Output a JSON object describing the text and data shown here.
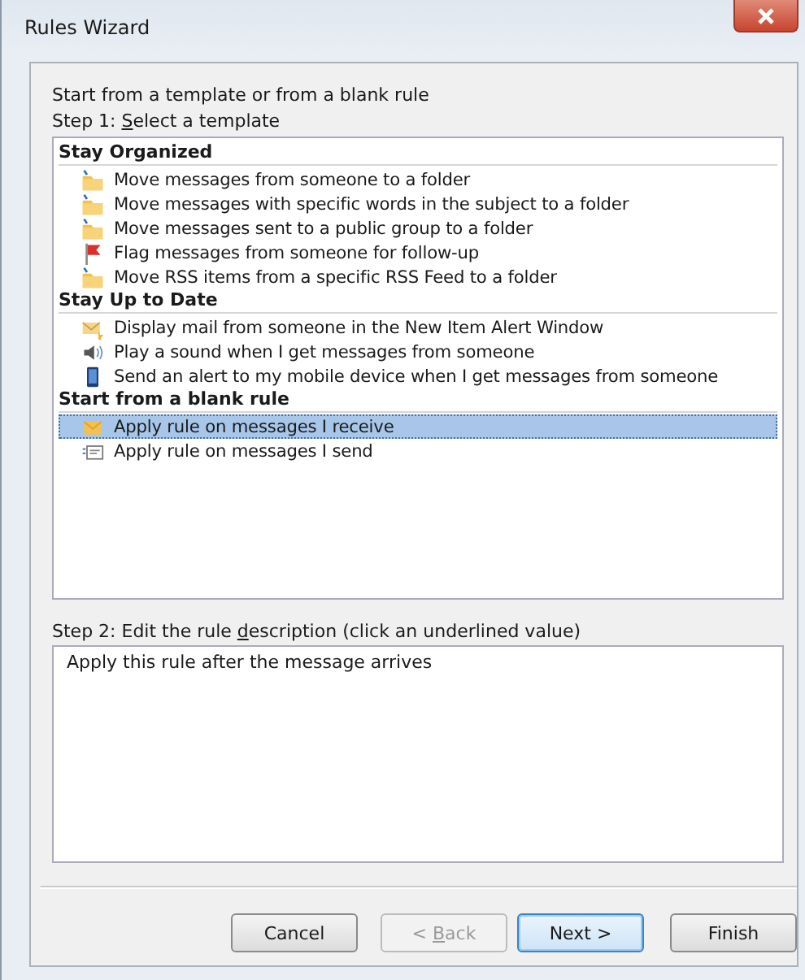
{
  "window": {
    "title": "Rules Wizard"
  },
  "intro": "Start from a template or from a blank rule",
  "step1": {
    "before": "Step 1: ",
    "access_key": "S",
    "after": "elect a template"
  },
  "groups": [
    {
      "title": "Stay Organized",
      "items": [
        {
          "label": "Move messages from someone to a folder",
          "kind": "folder",
          "selected": false
        },
        {
          "label": "Move messages with specific words in the subject to a folder",
          "kind": "folder",
          "selected": false
        },
        {
          "label": "Move messages sent to a public group to a folder",
          "kind": "folder",
          "selected": false
        },
        {
          "label": "Flag messages from someone for follow-up",
          "kind": "flag",
          "selected": false
        },
        {
          "label": "Move RSS items from a specific RSS Feed to a folder",
          "kind": "folder",
          "selected": false
        }
      ]
    },
    {
      "title": "Stay Up to Date",
      "items": [
        {
          "label": "Display mail from someone in the New Item Alert Window",
          "kind": "alert",
          "selected": false
        },
        {
          "label": "Play a sound when I get messages from someone",
          "kind": "sound",
          "selected": false
        },
        {
          "label": "Send an alert to my mobile device when I get messages from someone",
          "kind": "mobile",
          "selected": false
        }
      ]
    },
    {
      "title": "Start from a blank rule",
      "items": [
        {
          "label": "Apply rule on messages I receive",
          "kind": "receive",
          "selected": true
        },
        {
          "label": "Apply rule on messages I send",
          "kind": "send",
          "selected": false
        }
      ]
    }
  ],
  "step2": {
    "before": "Step 2: Edit the rule ",
    "access_key": "d",
    "after": "escription (click an underlined value)"
  },
  "description": "Apply this rule after the message arrives",
  "buttons": [
    {
      "label": "Cancel",
      "disabled": false,
      "default": false
    },
    {
      "before": "< ",
      "access_key": "B",
      "after": "ack",
      "disabled": true,
      "default": false
    },
    {
      "label": "Next >",
      "disabled": false,
      "default": true
    },
    {
      "label": "Finish",
      "disabled": false,
      "default": false
    }
  ]
}
